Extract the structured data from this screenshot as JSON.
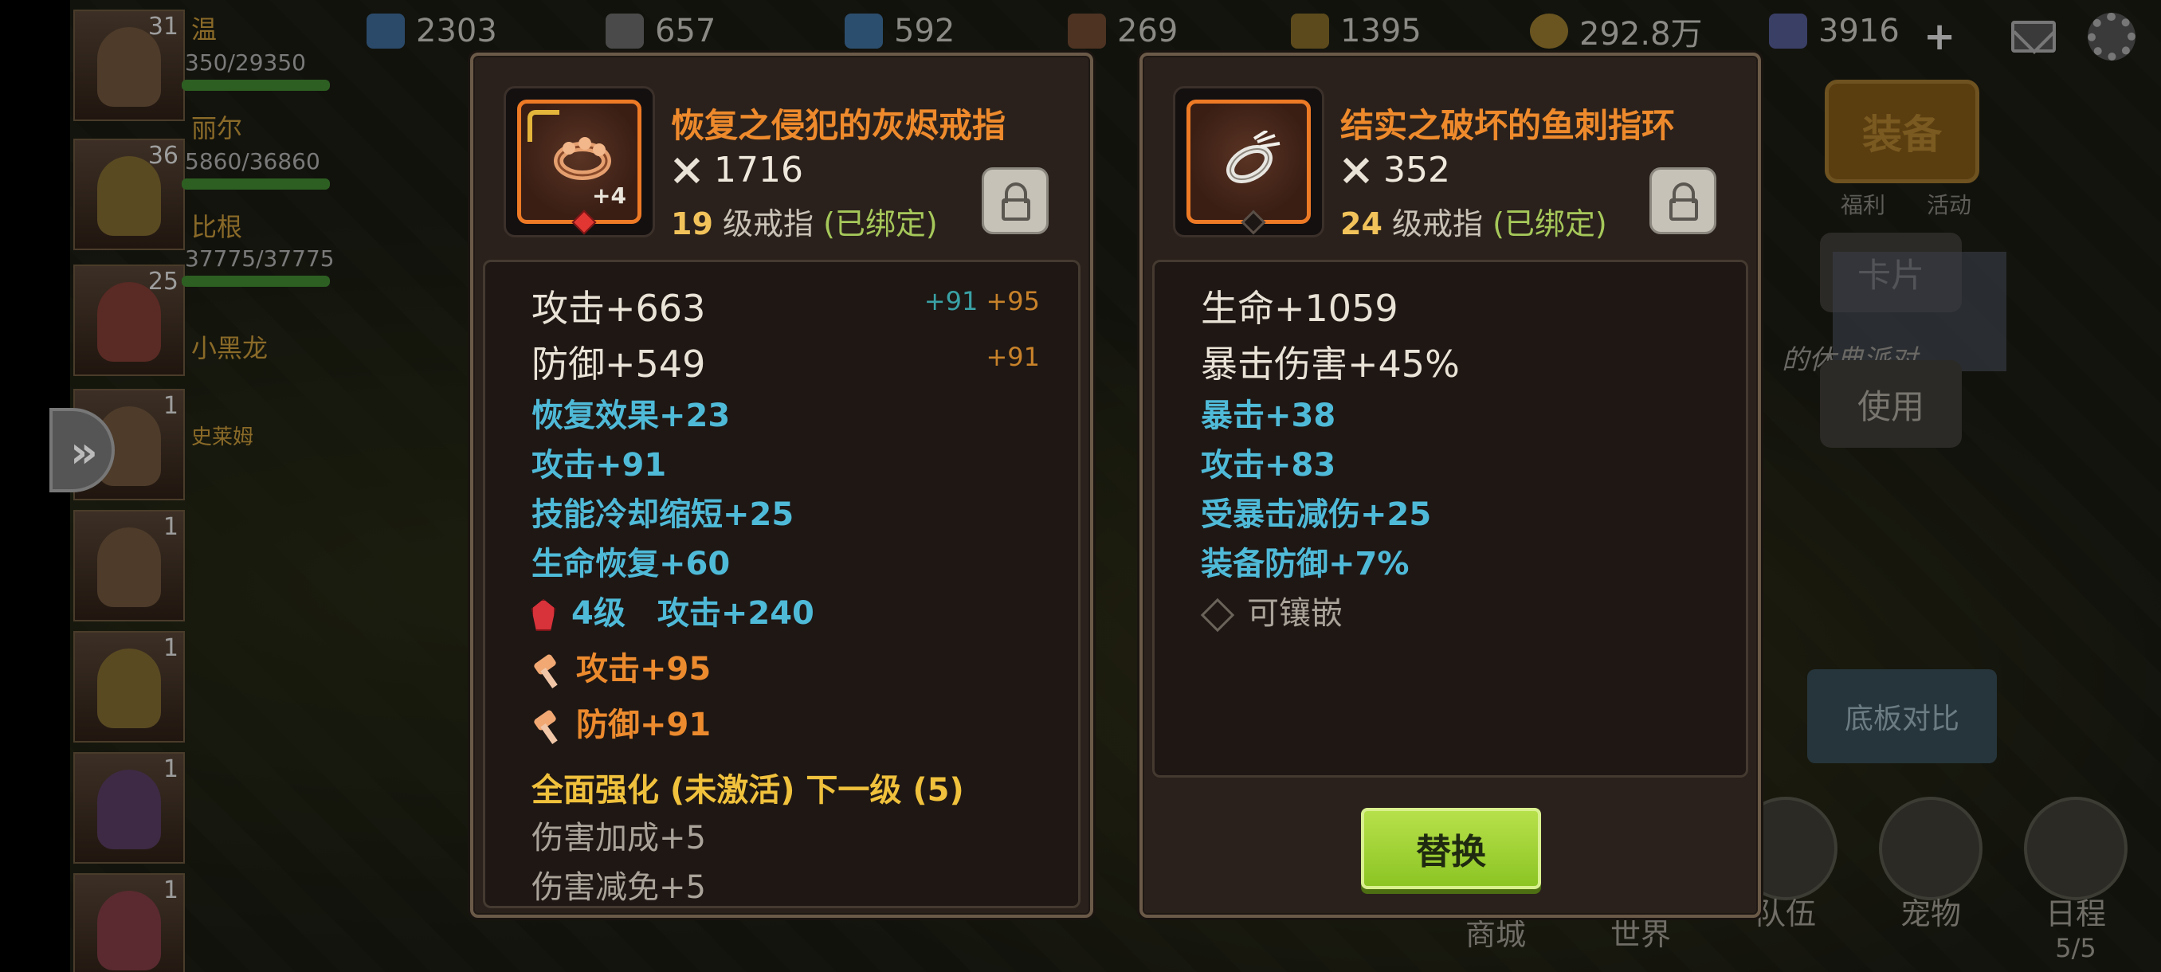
{
  "resources": [
    {
      "icon": "energy-crystal-icon",
      "value": "2303"
    },
    {
      "icon": "ore-icon",
      "value": "657"
    },
    {
      "icon": "crystal-icon",
      "value": "592"
    },
    {
      "icon": "wood-icon",
      "value": "269"
    },
    {
      "icon": "wheat-icon",
      "value": "1395"
    },
    {
      "icon": "gold-coin-icon",
      "value": "292.8万"
    },
    {
      "icon": "diamond-icon",
      "value": "3916"
    }
  ],
  "party": [
    {
      "name": "温",
      "level": "31",
      "hp": "350/29350"
    },
    {
      "name": "丽尔",
      "level": "36",
      "hp": "5860/36860"
    },
    {
      "name": "比根",
      "level": "",
      "hp": "37775/37775"
    },
    {
      "name": "小黑龙",
      "level": "25",
      "hp": ""
    },
    {
      "name": "史莱姆",
      "level": "1",
      "hp": ""
    },
    {
      "name": "",
      "level": "1",
      "hp": ""
    },
    {
      "name": "",
      "level": "1",
      "hp": ""
    },
    {
      "name": "",
      "level": "1",
      "hp": ""
    },
    {
      "name": "",
      "level": "1",
      "hp": ""
    }
  ],
  "side_buttons": {
    "equip": "装备",
    "card": "卡片",
    "use": "使用",
    "compare": "底板对比",
    "fuli": "福利",
    "activity": "活动",
    "party_banner": "的休典派对"
  },
  "bottom_nav": [
    "商城",
    "世界",
    "队伍",
    "宠物",
    "日程"
  ],
  "schedule_count": "5/5",
  "left_item": {
    "name": "恢复之侵犯的灰烬戒指",
    "enhance": "+4",
    "power": "1716",
    "level": "19",
    "type": "级戒指",
    "bound": "(已绑定)",
    "main_stats": [
      {
        "label": "攻击+663",
        "bonus1": "+91",
        "bonus2": "+95"
      },
      {
        "label": "防御+549",
        "bonus1": "",
        "bonus2": "+91"
      }
    ],
    "sub_stats": [
      "恢复效果+23",
      "攻击+91",
      "技能冷却缩短+25",
      "生命恢复+60"
    ],
    "gem_level": "4级",
    "gem_stat": "攻击+240",
    "forge_stats": [
      "攻击+95",
      "防御+91"
    ],
    "set_title": "全面强化 (未激活) 下一级 (5)",
    "set_stats": [
      "伤害加成+5",
      "伤害减免+5"
    ]
  },
  "right_item": {
    "name": "结实之破坏的鱼刺指环",
    "power": "352",
    "level": "24",
    "type": "级戒指",
    "bound": "(已绑定)",
    "main_stats": [
      "生命+1059",
      "暴击伤害+45%"
    ],
    "sub_stats": [
      "暴击+38",
      "攻击+83",
      "受暴击减伤+25",
      "装备防御+7%"
    ],
    "socket": "可镶嵌",
    "replace_label": "替换"
  },
  "colors": {
    "item_name": "#ee8a2c",
    "sub_stat": "#4fbad8",
    "bound": "#a6c85a",
    "level": "#f2c35a",
    "replace_button": "#9bd332"
  }
}
